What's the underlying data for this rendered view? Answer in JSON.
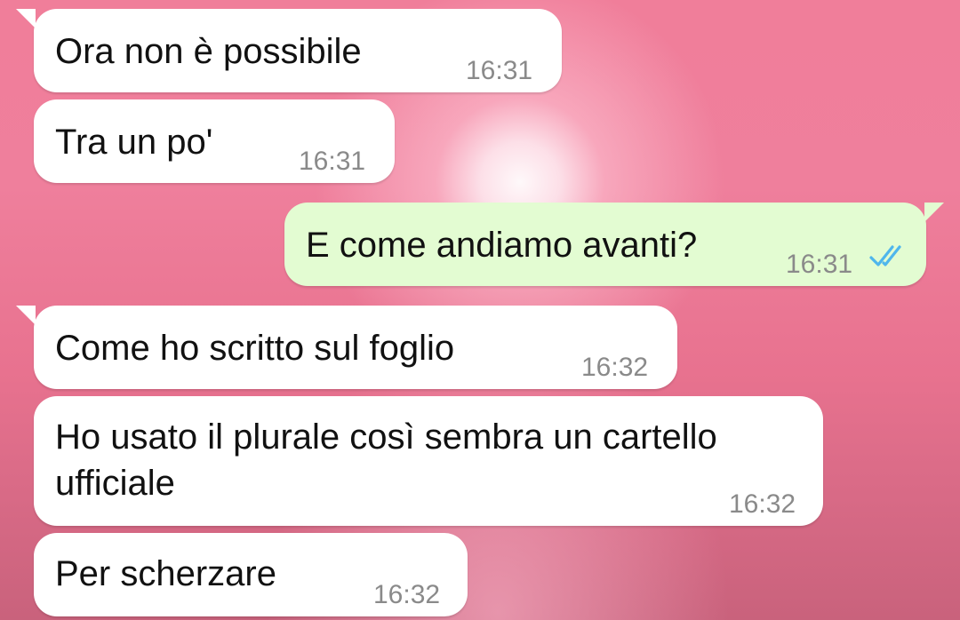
{
  "messages": [
    {
      "direction": "incoming",
      "text": "Ora non è possibile",
      "time": "16:31"
    },
    {
      "direction": "incoming",
      "text": "Tra un po'",
      "time": "16:31"
    },
    {
      "direction": "outgoing",
      "text": "E come andiamo avanti?",
      "time": "16:31",
      "status": "read-double-check-icon"
    },
    {
      "direction": "incoming",
      "text": "Come ho scritto sul foglio",
      "time": "16:32"
    },
    {
      "direction": "incoming",
      "text": "Ho usato il plurale così sembra un cartello\nufficiale",
      "time": "16:32"
    },
    {
      "direction": "incoming",
      "text": "Per scherzare",
      "time": "16:32"
    }
  ],
  "colors": {
    "incoming_bubble": "#ffffff",
    "outgoing_bubble": "#e3fcd2",
    "read_ticks": "#4fb6ec",
    "time_text": "#8a8a8a"
  }
}
